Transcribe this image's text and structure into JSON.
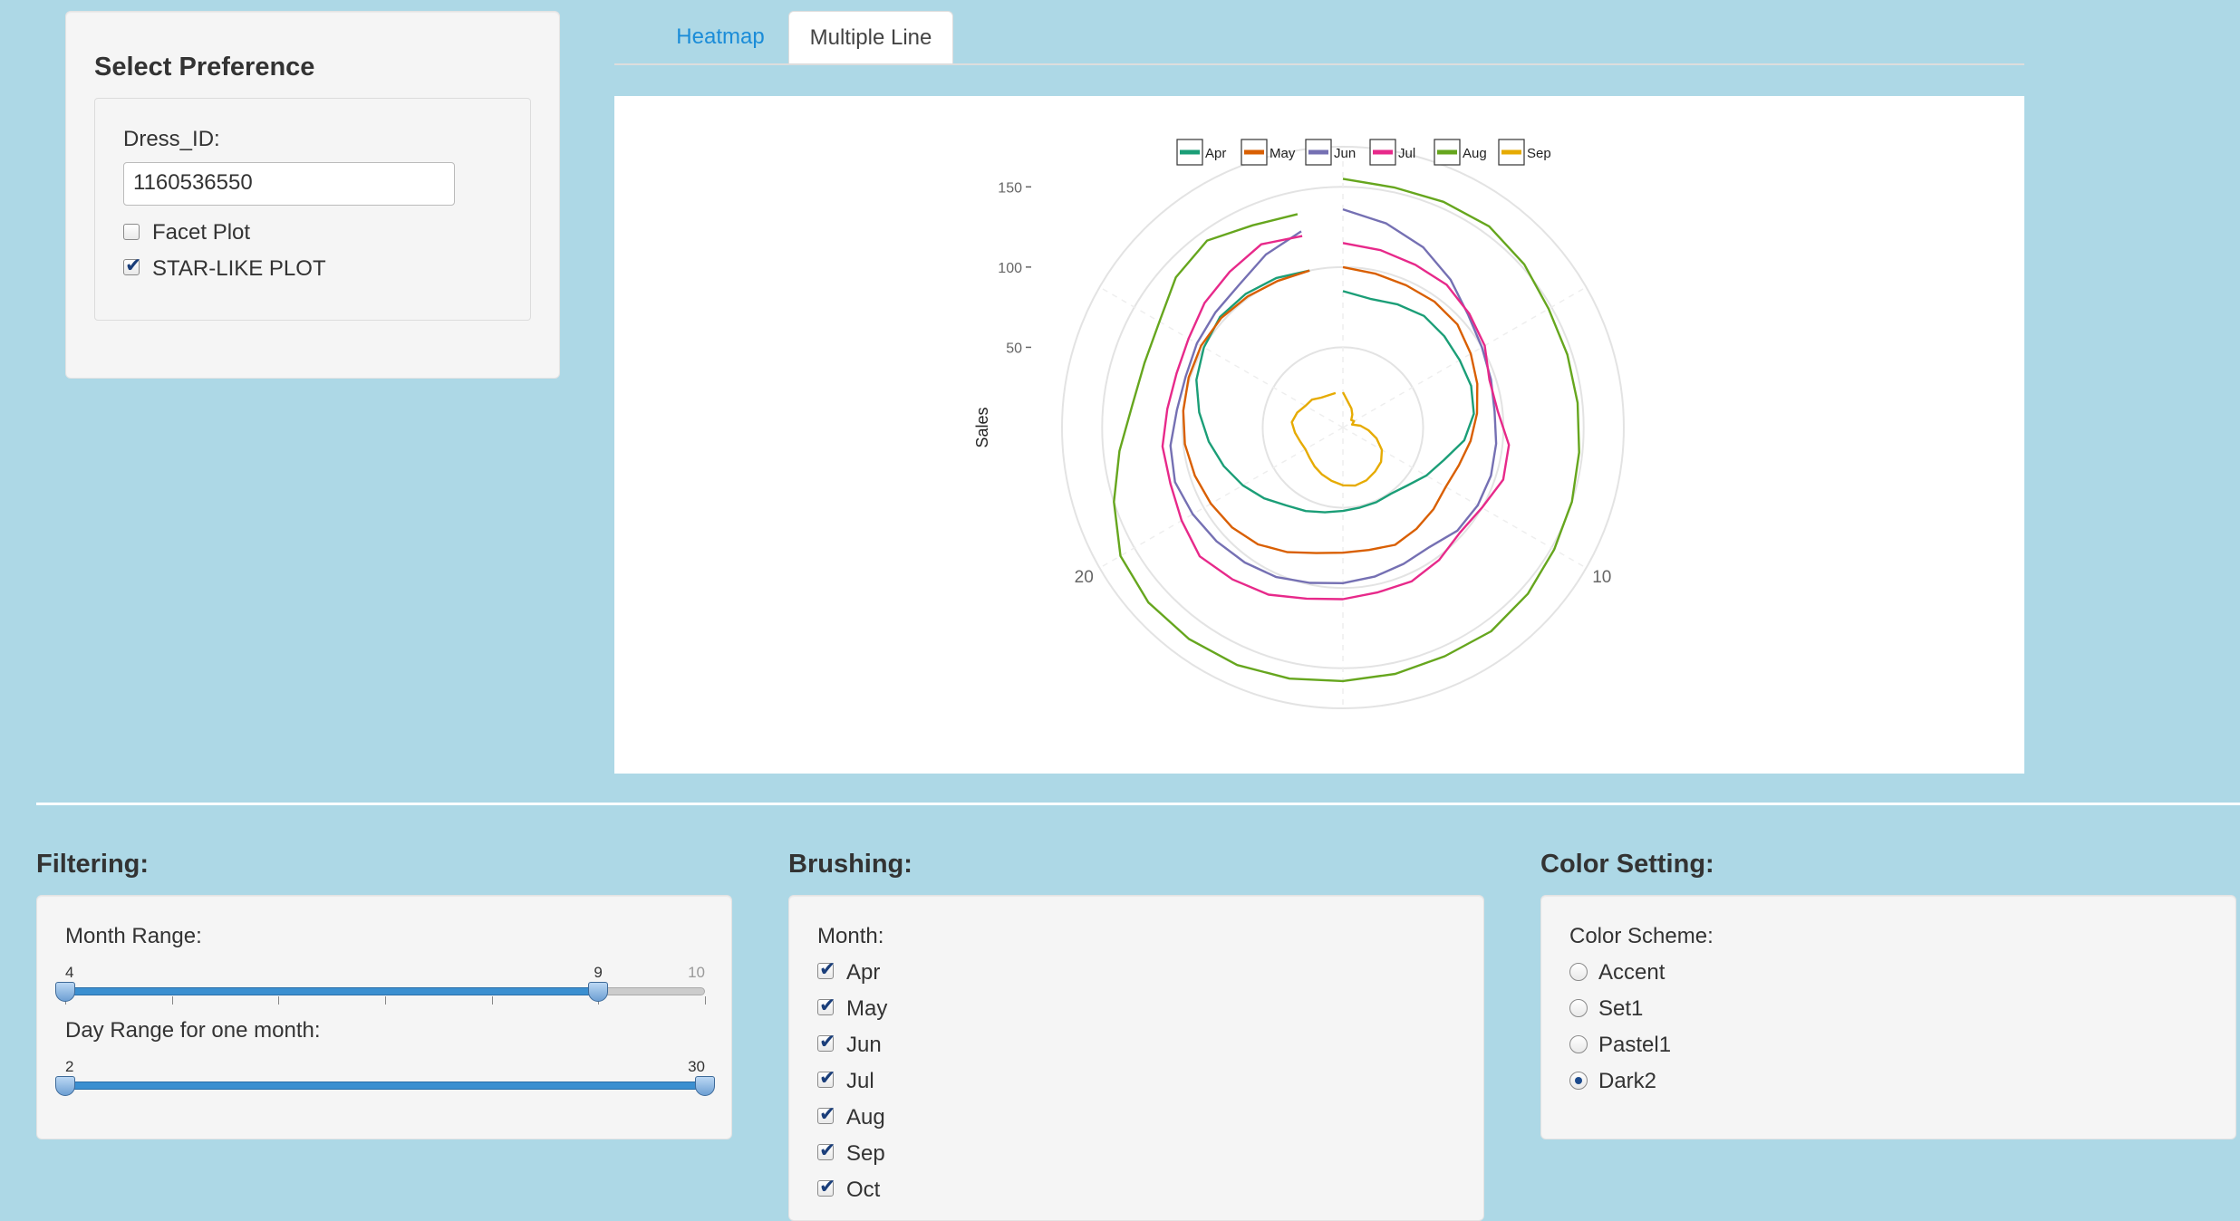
{
  "preference": {
    "title": "Select Preference",
    "dress_label": "Dress_ID:",
    "dress_value": "1160536550",
    "facet_label": "Facet Plot",
    "facet_checked": false,
    "star_label": "STAR-LIKE PLOT",
    "star_checked": true
  },
  "tabs": [
    {
      "label": "Heatmap",
      "active": false
    },
    {
      "label": "Multiple Line",
      "active": true
    }
  ],
  "chart_data": {
    "type": "line",
    "coord": "polar",
    "ylabel": "Sales",
    "y_ticks": [
      "50",
      "100",
      "150"
    ],
    "angle_labels": [
      "10",
      "20"
    ],
    "legend_placement": "top",
    "grid": true,
    "series": [
      {
        "name": "Apr",
        "color": "#1b9e77",
        "values": [
          85,
          82,
          84,
          86,
          85,
          84,
          84,
          82,
          76,
          66,
          60,
          54,
          51,
          51,
          51,
          52,
          54,
          57,
          60,
          66,
          72,
          78,
          84,
          90,
          96,
          100,
          103,
          103,
          102,
          100
        ]
      },
      {
        "name": "May",
        "color": "#d95f02",
        "values": [
          100,
          98,
          97,
          97,
          96,
          92,
          88,
          84,
          80,
          76,
          74,
          76,
          78,
          80,
          78,
          78,
          80,
          85,
          90,
          93,
          95,
          97,
          99,
          100,
          101,
          102,
          102,
          101,
          100,
          100
        ]
      },
      {
        "name": "Jun",
        "color": "#7570b3",
        "values": [
          136,
          130,
          123,
          114,
          105,
          100,
          97,
          95,
          96,
          97,
          97,
          96,
          92,
          93,
          95,
          97,
          99,
          102,
          104,
          106,
          108,
          110,
          108,
          104,
          103,
          105,
          107,
          110,
          118,
          125
        ]
      },
      {
        "name": "Jul",
        "color": "#e7298a",
        "values": [
          115,
          113,
          111,
          110,
          106,
          102,
          96,
          97,
          104,
          105,
          100,
          98,
          102,
          105,
          105,
          107,
          109,
          114,
          117,
          120,
          116,
          113,
          113,
          110,
          109,
          111,
          116,
          120,
          125,
          122
        ]
      },
      {
        "name": "Aug",
        "color": "#66a61e",
        "values": [
          155,
          153,
          154,
          155,
          152,
          148,
          147,
          147,
          148,
          150,
          152,
          155,
          157,
          156,
          157,
          158,
          160,
          162,
          163,
          163,
          160,
          150,
          140,
          132,
          130,
          132,
          140,
          144,
          138,
          136
        ]
      },
      {
        "name": "Sep",
        "color": "#e6ab02",
        "values": [
          22,
          16,
          13,
          10,
          7,
          8,
          6,
          11,
          16,
          22,
          28,
          32,
          34,
          36,
          37,
          36,
          34,
          32,
          30,
          28,
          27,
          28,
          30,
          32,
          30,
          27,
          26,
          23,
          22,
          22
        ]
      }
    ],
    "x": [
      1,
      2,
      3,
      4,
      5,
      6,
      7,
      8,
      9,
      10,
      11,
      12,
      13,
      14,
      15,
      16,
      17,
      18,
      19,
      20,
      21,
      22,
      23,
      24,
      25,
      26,
      27,
      28,
      29,
      30
    ],
    "ylim": [
      0,
      175
    ]
  },
  "filtering": {
    "title": "Filtering:",
    "month_label": "Month Range:",
    "month_min": 4,
    "month_max": 10,
    "month_from": 4,
    "month_to": 9,
    "month_from_label": "4",
    "month_to_label": "9",
    "month_max_label": "10",
    "day_label": "Day Range for one month:",
    "day_from_label": "2",
    "day_to_label": "30",
    "day_fill_fraction": 1.0
  },
  "brushing": {
    "title": "Brushing:",
    "month_label": "Month:",
    "months": [
      {
        "label": "Apr",
        "checked": true
      },
      {
        "label": "May",
        "checked": true
      },
      {
        "label": "Jun",
        "checked": true
      },
      {
        "label": "Jul",
        "checked": true
      },
      {
        "label": "Aug",
        "checked": true
      },
      {
        "label": "Sep",
        "checked": true
      },
      {
        "label": "Oct",
        "checked": true
      }
    ]
  },
  "color_setting": {
    "title": "Color Setting:",
    "scheme_label": "Color Scheme:",
    "options": [
      {
        "label": "Accent",
        "selected": false
      },
      {
        "label": "Set1",
        "selected": false
      },
      {
        "label": "Pastel1",
        "selected": false
      },
      {
        "label": "Dark2",
        "selected": true
      }
    ]
  }
}
